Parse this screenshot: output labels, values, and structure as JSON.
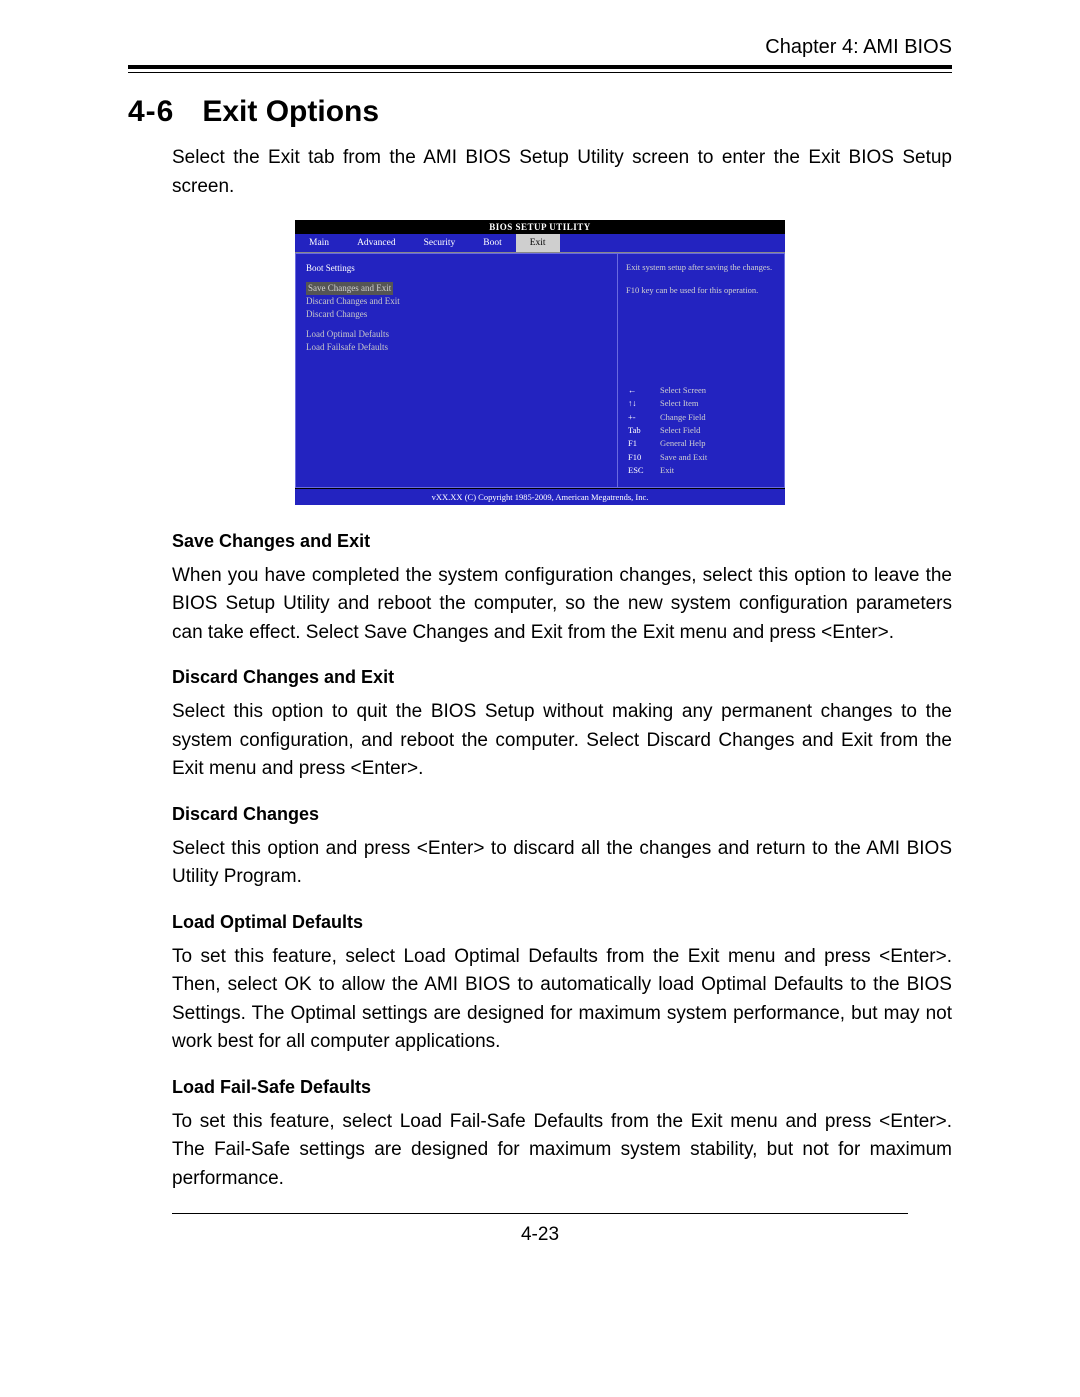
{
  "header": {
    "chapter": "Chapter 4: AMI BIOS"
  },
  "section": {
    "number": "4-6",
    "title": "Exit Options"
  },
  "intro": "Select the Exit tab from the AMI BIOS Setup Utility screen to enter the Exit BIOS Setup screen.",
  "bios": {
    "title": "BIOS SETUP UTILITY",
    "tabs": [
      "Main",
      "Advanced",
      "Security",
      "Boot",
      "Exit"
    ],
    "active_tab": "Exit",
    "left_heading": "Boot Settings",
    "menu": [
      "Save Changes and Exit",
      "Discard Changes and Exit",
      "Discard Changes",
      "",
      "Load Optimal Defaults",
      "Load Failsafe Defaults"
    ],
    "help_top": "Exit system setup after saving the changes.\n\nF10 key can be used for this operation.",
    "keys": [
      [
        "←",
        "Select Screen"
      ],
      [
        "↑↓",
        "Select Item"
      ],
      [
        "+-",
        "Change Field"
      ],
      [
        "Tab",
        "Select Field"
      ],
      [
        "F1",
        "General Help"
      ],
      [
        "F10",
        "Save and Exit"
      ],
      [
        "ESC",
        "Exit"
      ]
    ],
    "footer": "vXX.XX (C) Copyright 1985-2009, American Megatrends, Inc."
  },
  "sections": [
    {
      "title": "Save Changes and Exit",
      "body": "When you have completed the system configuration changes, select this option to leave the BIOS Setup Utility and reboot the computer, so the new system configuration parameters can take effect. Select Save Changes and Exit from the Exit menu and press <Enter>."
    },
    {
      "title": "Discard Changes and Exit",
      "body": "Select this option to quit the BIOS Setup without making any permanent changes to the system configuration, and reboot the computer. Select Discard Changes and Exit from the Exit menu and press <Enter>."
    },
    {
      "title": "Discard Changes",
      "body": "Select this option and press <Enter> to discard all the changes and return to the AMI BIOS Utility Program."
    },
    {
      "title": "Load Optimal Defaults",
      "body": "To set this feature, select Load Optimal Defaults from the Exit menu and press <Enter>. Then, select OK to allow the AMI BIOS to automatically load Optimal Defaults to the BIOS Settings. The Optimal settings are designed for maximum system performance, but may not work best for all computer applications."
    },
    {
      "title": "Load Fail-Safe Defaults",
      "body": "To set this feature, select Load Fail-Safe Defaults from the Exit menu and press <Enter>. The Fail-Safe settings are designed for maximum system stability, but not for maximum performance."
    }
  ],
  "page_number": "4-23"
}
